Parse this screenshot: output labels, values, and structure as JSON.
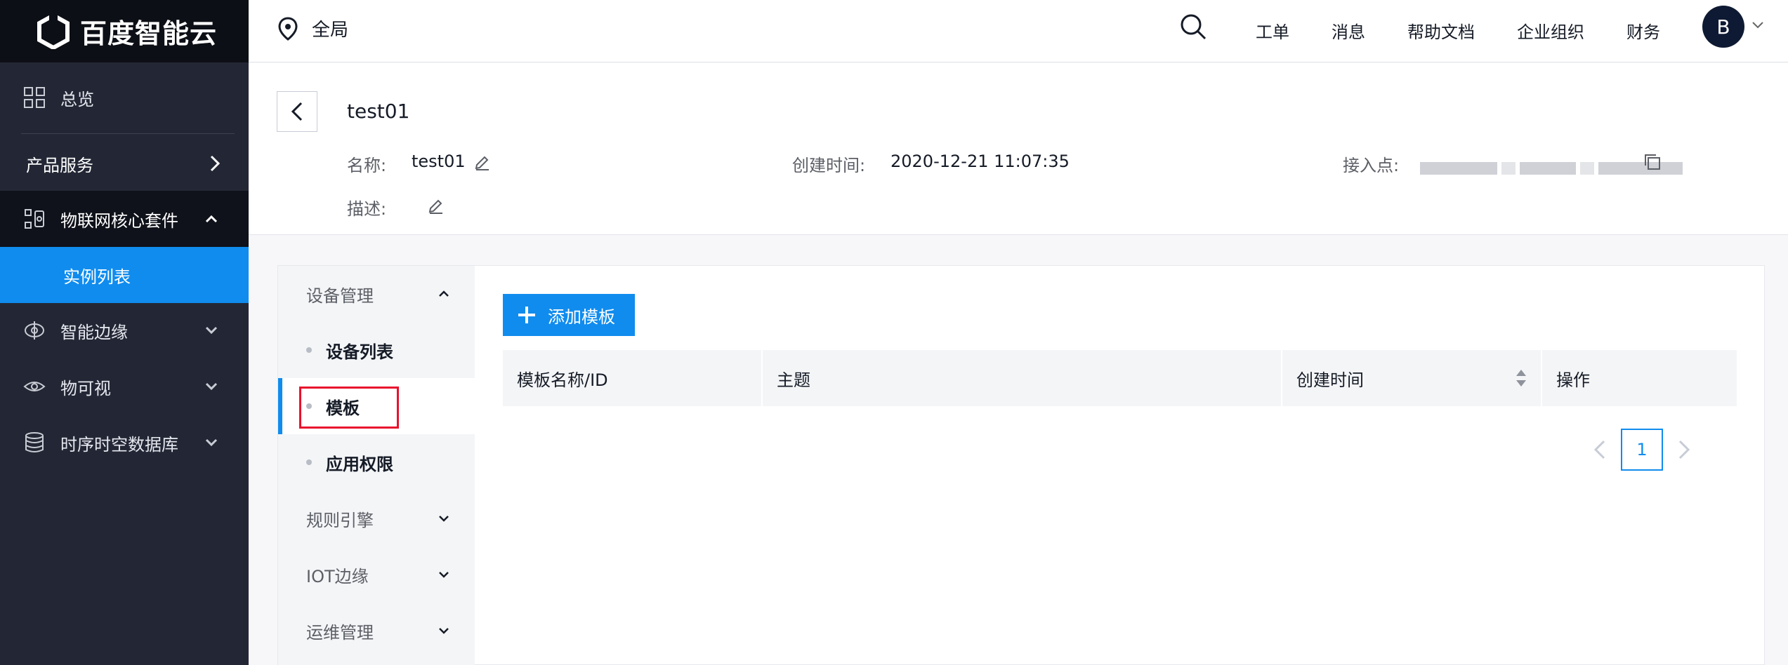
{
  "brand": {
    "logo_text": "百度智能云"
  },
  "sidebar": {
    "overview": "总览",
    "products": "产品服务",
    "iot_core": "物联网核心套件",
    "instance_list": "实例列表",
    "edge": "智能边缘",
    "visual": "物可视",
    "tsdb": "时序时空数据库"
  },
  "header": {
    "region": "全局",
    "links": [
      "工单",
      "消息",
      "帮助文档",
      "企业组织",
      "财务"
    ],
    "avatar_letter": "B"
  },
  "detail": {
    "title": "test01",
    "name_label": "名称:",
    "name_value": "test01",
    "created_label": "创建时间:",
    "created_value": "2020-12-21 11:07:35",
    "endpoint_label": "接入点:",
    "desc_label": "描述:"
  },
  "subnav": {
    "device_mgmt": "设备管理",
    "device_list": "设备列表",
    "template": "模板",
    "app_perm": "应用权限",
    "rule_engine": "规则引擎",
    "iot_edge": "IOT边缘",
    "ops_mgmt": "运维管理"
  },
  "content": {
    "add_button": "添加模板",
    "columns": [
      "模板名称/ID",
      "主题",
      "创建时间",
      "操作"
    ],
    "current_page": "1"
  },
  "colors": {
    "accent": "#108cee",
    "sidebar_bg": "#232735",
    "highlight": "#e8112d"
  }
}
